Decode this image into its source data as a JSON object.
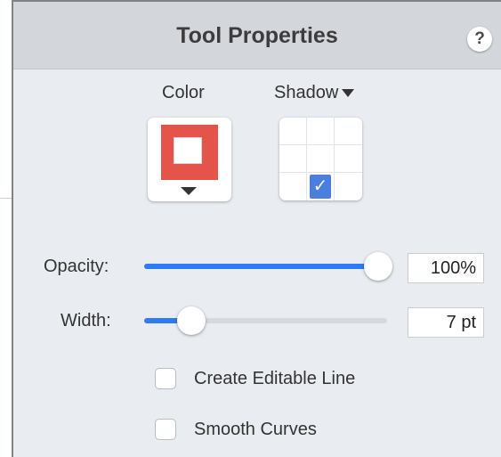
{
  "panel": {
    "title": "Tool Properties",
    "help_label": "?"
  },
  "color": {
    "label": "Color",
    "value": "#e5544b"
  },
  "shadow": {
    "label": "Shadow",
    "selected_cell": "bottom-center"
  },
  "opacity": {
    "label": "Opacity:",
    "value": "100%",
    "fraction": 1.0
  },
  "width": {
    "label": "Width:",
    "value": "7 pt",
    "fraction": 0.17
  },
  "options": {
    "create_editable_line": "Create Editable Line",
    "smooth_curves": "Smooth Curves"
  },
  "colors": {
    "accent": "#2f7bf5",
    "check": "#4a7fe0"
  }
}
